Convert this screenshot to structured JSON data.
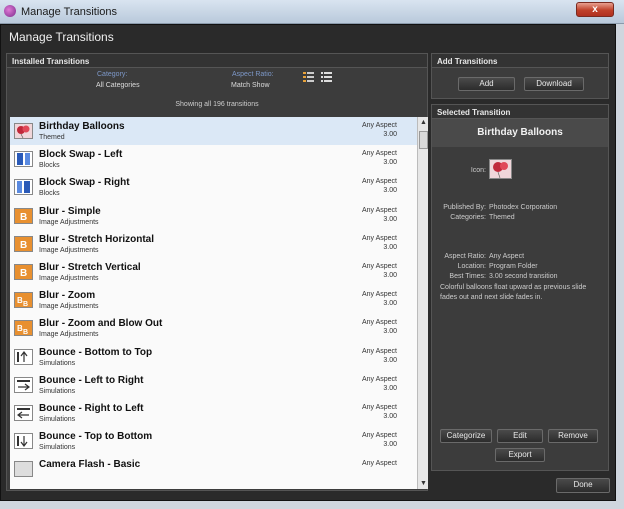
{
  "window": {
    "title": "Manage Transitions",
    "close_label": "x"
  },
  "dialog": {
    "header": "Manage Transitions",
    "done_label": "Done"
  },
  "installed": {
    "heading": "Installed Transitions",
    "category_label": "Category:",
    "category_value": "All Categories",
    "aspect_label": "Aspect Ratio:",
    "aspect_value": "Match Show",
    "count_text": "Showing all 196 transitions",
    "items": [
      {
        "name": "Birthday Balloons",
        "category": "Themed",
        "aspect": "Any Aspect",
        "time": "3.00",
        "icon": "balloon-icon"
      },
      {
        "name": "Block Swap - Left",
        "category": "Blocks",
        "aspect": "Any Aspect",
        "time": "3.00",
        "icon": "blocks-icon"
      },
      {
        "name": "Block Swap - Right",
        "category": "Blocks",
        "aspect": "Any Aspect",
        "time": "3.00",
        "icon": "blocks-icon"
      },
      {
        "name": "Blur - Simple",
        "category": "Image Adjustments",
        "aspect": "Any Aspect",
        "time": "3.00",
        "icon": "blur-icon"
      },
      {
        "name": "Blur - Stretch Horizontal",
        "category": "Image Adjustments",
        "aspect": "Any Aspect",
        "time": "3.00",
        "icon": "blur-icon"
      },
      {
        "name": "Blur - Stretch Vertical",
        "category": "Image Adjustments",
        "aspect": "Any Aspect",
        "time": "3.00",
        "icon": "blur-icon"
      },
      {
        "name": "Blur - Zoom",
        "category": "Image Adjustments",
        "aspect": "Any Aspect",
        "time": "3.00",
        "icon": "blur-icon"
      },
      {
        "name": "Blur - Zoom and Blow Out",
        "category": "Image Adjustments",
        "aspect": "Any Aspect",
        "time": "3.00",
        "icon": "blur-icon"
      },
      {
        "name": "Bounce - Bottom to Top",
        "category": "Simulations",
        "aspect": "Any Aspect",
        "time": "3.00",
        "icon": "bounce-icon"
      },
      {
        "name": "Bounce - Left to Right",
        "category": "Simulations",
        "aspect": "Any Aspect",
        "time": "3.00",
        "icon": "bounce-icon"
      },
      {
        "name": "Bounce - Right to Left",
        "category": "Simulations",
        "aspect": "Any Aspect",
        "time": "3.00",
        "icon": "bounce-icon"
      },
      {
        "name": "Bounce - Top to Bottom",
        "category": "Simulations",
        "aspect": "Any Aspect",
        "time": "3.00",
        "icon": "bounce-icon"
      },
      {
        "name": "Camera Flash - Basic",
        "category": "",
        "aspect": "Any Aspect",
        "time": "",
        "icon": "flash-icon"
      }
    ]
  },
  "add": {
    "heading": "Add Transitions",
    "add_label": "Add",
    "download_label": "Download"
  },
  "selected": {
    "heading": "Selected Transition",
    "name": "Birthday Balloons",
    "icon_label": "Icon:",
    "published_label": "Published By:",
    "published_value": "Photodex Corporation",
    "categories_label": "Categories:",
    "categories_value": "Themed",
    "aspect_label": "Aspect Ratio:",
    "aspect_value": "Any Aspect",
    "location_label": "Location:",
    "location_value": "Program Folder",
    "times_label": "Best Times:",
    "times_value": "3.00 second transition",
    "description": "Colorful balloons float upward as previous slide fades out and next slide fades in.",
    "categorize_label": "Categorize",
    "edit_label": "Edit",
    "remove_label": "Remove",
    "export_label": "Export"
  }
}
